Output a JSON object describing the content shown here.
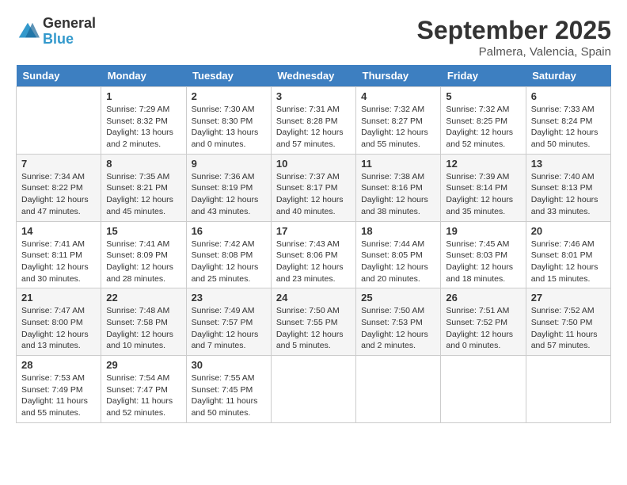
{
  "logo": {
    "general": "General",
    "blue": "Blue"
  },
  "title": "September 2025",
  "subtitle": "Palmera, Valencia, Spain",
  "days_of_week": [
    "Sunday",
    "Monday",
    "Tuesday",
    "Wednesday",
    "Thursday",
    "Friday",
    "Saturday"
  ],
  "weeks": [
    [
      {
        "day": "",
        "info": ""
      },
      {
        "day": "1",
        "info": "Sunrise: 7:29 AM\nSunset: 8:32 PM\nDaylight: 13 hours\nand 2 minutes."
      },
      {
        "day": "2",
        "info": "Sunrise: 7:30 AM\nSunset: 8:30 PM\nDaylight: 13 hours\nand 0 minutes."
      },
      {
        "day": "3",
        "info": "Sunrise: 7:31 AM\nSunset: 8:28 PM\nDaylight: 12 hours\nand 57 minutes."
      },
      {
        "day": "4",
        "info": "Sunrise: 7:32 AM\nSunset: 8:27 PM\nDaylight: 12 hours\nand 55 minutes."
      },
      {
        "day": "5",
        "info": "Sunrise: 7:32 AM\nSunset: 8:25 PM\nDaylight: 12 hours\nand 52 minutes."
      },
      {
        "day": "6",
        "info": "Sunrise: 7:33 AM\nSunset: 8:24 PM\nDaylight: 12 hours\nand 50 minutes."
      }
    ],
    [
      {
        "day": "7",
        "info": "Sunrise: 7:34 AM\nSunset: 8:22 PM\nDaylight: 12 hours\nand 47 minutes."
      },
      {
        "day": "8",
        "info": "Sunrise: 7:35 AM\nSunset: 8:21 PM\nDaylight: 12 hours\nand 45 minutes."
      },
      {
        "day": "9",
        "info": "Sunrise: 7:36 AM\nSunset: 8:19 PM\nDaylight: 12 hours\nand 43 minutes."
      },
      {
        "day": "10",
        "info": "Sunrise: 7:37 AM\nSunset: 8:17 PM\nDaylight: 12 hours\nand 40 minutes."
      },
      {
        "day": "11",
        "info": "Sunrise: 7:38 AM\nSunset: 8:16 PM\nDaylight: 12 hours\nand 38 minutes."
      },
      {
        "day": "12",
        "info": "Sunrise: 7:39 AM\nSunset: 8:14 PM\nDaylight: 12 hours\nand 35 minutes."
      },
      {
        "day": "13",
        "info": "Sunrise: 7:40 AM\nSunset: 8:13 PM\nDaylight: 12 hours\nand 33 minutes."
      }
    ],
    [
      {
        "day": "14",
        "info": "Sunrise: 7:41 AM\nSunset: 8:11 PM\nDaylight: 12 hours\nand 30 minutes."
      },
      {
        "day": "15",
        "info": "Sunrise: 7:41 AM\nSunset: 8:09 PM\nDaylight: 12 hours\nand 28 minutes."
      },
      {
        "day": "16",
        "info": "Sunrise: 7:42 AM\nSunset: 8:08 PM\nDaylight: 12 hours\nand 25 minutes."
      },
      {
        "day": "17",
        "info": "Sunrise: 7:43 AM\nSunset: 8:06 PM\nDaylight: 12 hours\nand 23 minutes."
      },
      {
        "day": "18",
        "info": "Sunrise: 7:44 AM\nSunset: 8:05 PM\nDaylight: 12 hours\nand 20 minutes."
      },
      {
        "day": "19",
        "info": "Sunrise: 7:45 AM\nSunset: 8:03 PM\nDaylight: 12 hours\nand 18 minutes."
      },
      {
        "day": "20",
        "info": "Sunrise: 7:46 AM\nSunset: 8:01 PM\nDaylight: 12 hours\nand 15 minutes."
      }
    ],
    [
      {
        "day": "21",
        "info": "Sunrise: 7:47 AM\nSunset: 8:00 PM\nDaylight: 12 hours\nand 13 minutes."
      },
      {
        "day": "22",
        "info": "Sunrise: 7:48 AM\nSunset: 7:58 PM\nDaylight: 12 hours\nand 10 minutes."
      },
      {
        "day": "23",
        "info": "Sunrise: 7:49 AM\nSunset: 7:57 PM\nDaylight: 12 hours\nand 7 minutes."
      },
      {
        "day": "24",
        "info": "Sunrise: 7:50 AM\nSunset: 7:55 PM\nDaylight: 12 hours\nand 5 minutes."
      },
      {
        "day": "25",
        "info": "Sunrise: 7:50 AM\nSunset: 7:53 PM\nDaylight: 12 hours\nand 2 minutes."
      },
      {
        "day": "26",
        "info": "Sunrise: 7:51 AM\nSunset: 7:52 PM\nDaylight: 12 hours\nand 0 minutes."
      },
      {
        "day": "27",
        "info": "Sunrise: 7:52 AM\nSunset: 7:50 PM\nDaylight: 11 hours\nand 57 minutes."
      }
    ],
    [
      {
        "day": "28",
        "info": "Sunrise: 7:53 AM\nSunset: 7:49 PM\nDaylight: 11 hours\nand 55 minutes."
      },
      {
        "day": "29",
        "info": "Sunrise: 7:54 AM\nSunset: 7:47 PM\nDaylight: 11 hours\nand 52 minutes."
      },
      {
        "day": "30",
        "info": "Sunrise: 7:55 AM\nSunset: 7:45 PM\nDaylight: 11 hours\nand 50 minutes."
      },
      {
        "day": "",
        "info": ""
      },
      {
        "day": "",
        "info": ""
      },
      {
        "day": "",
        "info": ""
      },
      {
        "day": "",
        "info": ""
      }
    ]
  ]
}
